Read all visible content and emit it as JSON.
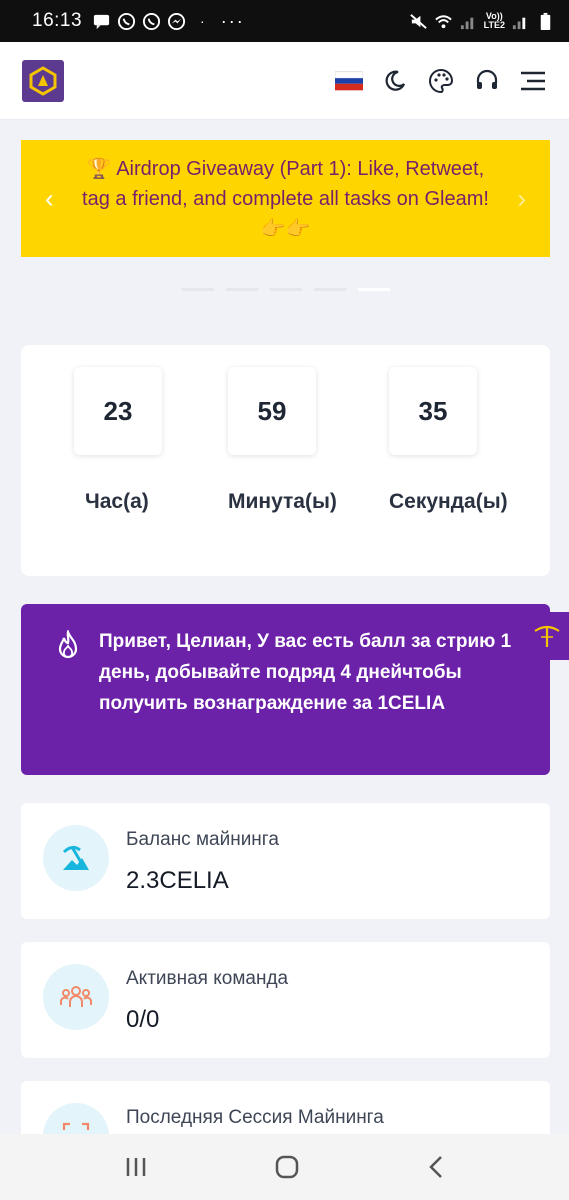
{
  "status_bar": {
    "time": "16:13",
    "carrier_top": "Vo))",
    "carrier_bottom": "LTE2"
  },
  "header": {
    "icons": [
      "app-logo",
      "russian-flag-icon",
      "moon-icon",
      "palette-icon",
      "headset-icon",
      "menu-icon"
    ]
  },
  "banner": {
    "text": "🏆 Airdrop Giveaway (Part 1): Like, Retweet, tag a friend, and complete all tasks on Gleam! 👉👉",
    "prev": "‹",
    "next": "›",
    "slides": 5,
    "active_slide": 5
  },
  "countdown": {
    "hours": "23",
    "minutes": "59",
    "seconds": "35",
    "hours_label": "Час(а)",
    "minutes_label": "Минута(ы)",
    "seconds_label": "Секунда(ы)"
  },
  "streak": {
    "text": "Привет, Целиан, У вас есть балл за стрию 1 день, добывайте подряд 4 днейчтобы получить вознаграждение за 1CELIA"
  },
  "cards": {
    "balance_label": "Баланс майнинга",
    "balance_value": "2.3CELIA",
    "team_label": "Активная команда",
    "team_value": "0/0",
    "session_label": "Последняя Сессия Майнинга"
  },
  "colors": {
    "banner_bg": "#ffd500",
    "banner_text": "#7a1f6a",
    "streak_bg": "#6b21a8",
    "page_bg": "#f0f2f7"
  }
}
